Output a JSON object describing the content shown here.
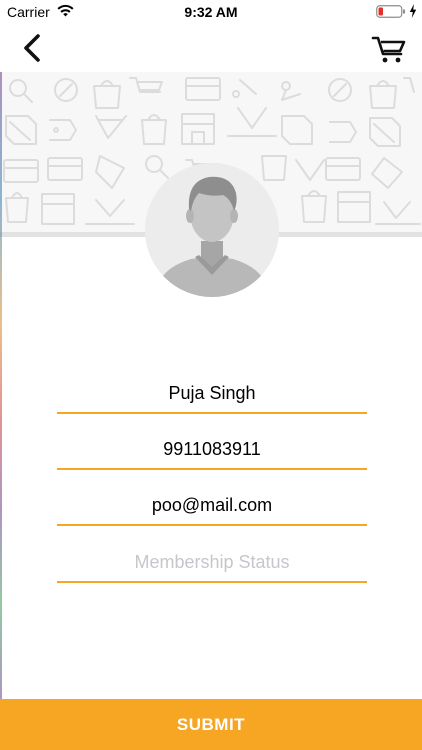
{
  "status_bar": {
    "carrier": "Carrier",
    "time": "9:32 AM"
  },
  "nav": {
    "back_icon": "chevron-left-icon",
    "cart_icon": "cart-icon"
  },
  "profile": {
    "avatar_icon": "user-avatar-icon"
  },
  "form": {
    "name_value": "Puja Singh",
    "phone_value": "9911083911",
    "email_value": "poo@mail.com",
    "membership_placeholder": "Membership Status"
  },
  "submit": {
    "label": "SUBMIT"
  },
  "colors": {
    "accent": "#f7a623",
    "underline": "#f5a623",
    "placeholder": "#c6c6cc",
    "battery_low": "#e0312c"
  }
}
